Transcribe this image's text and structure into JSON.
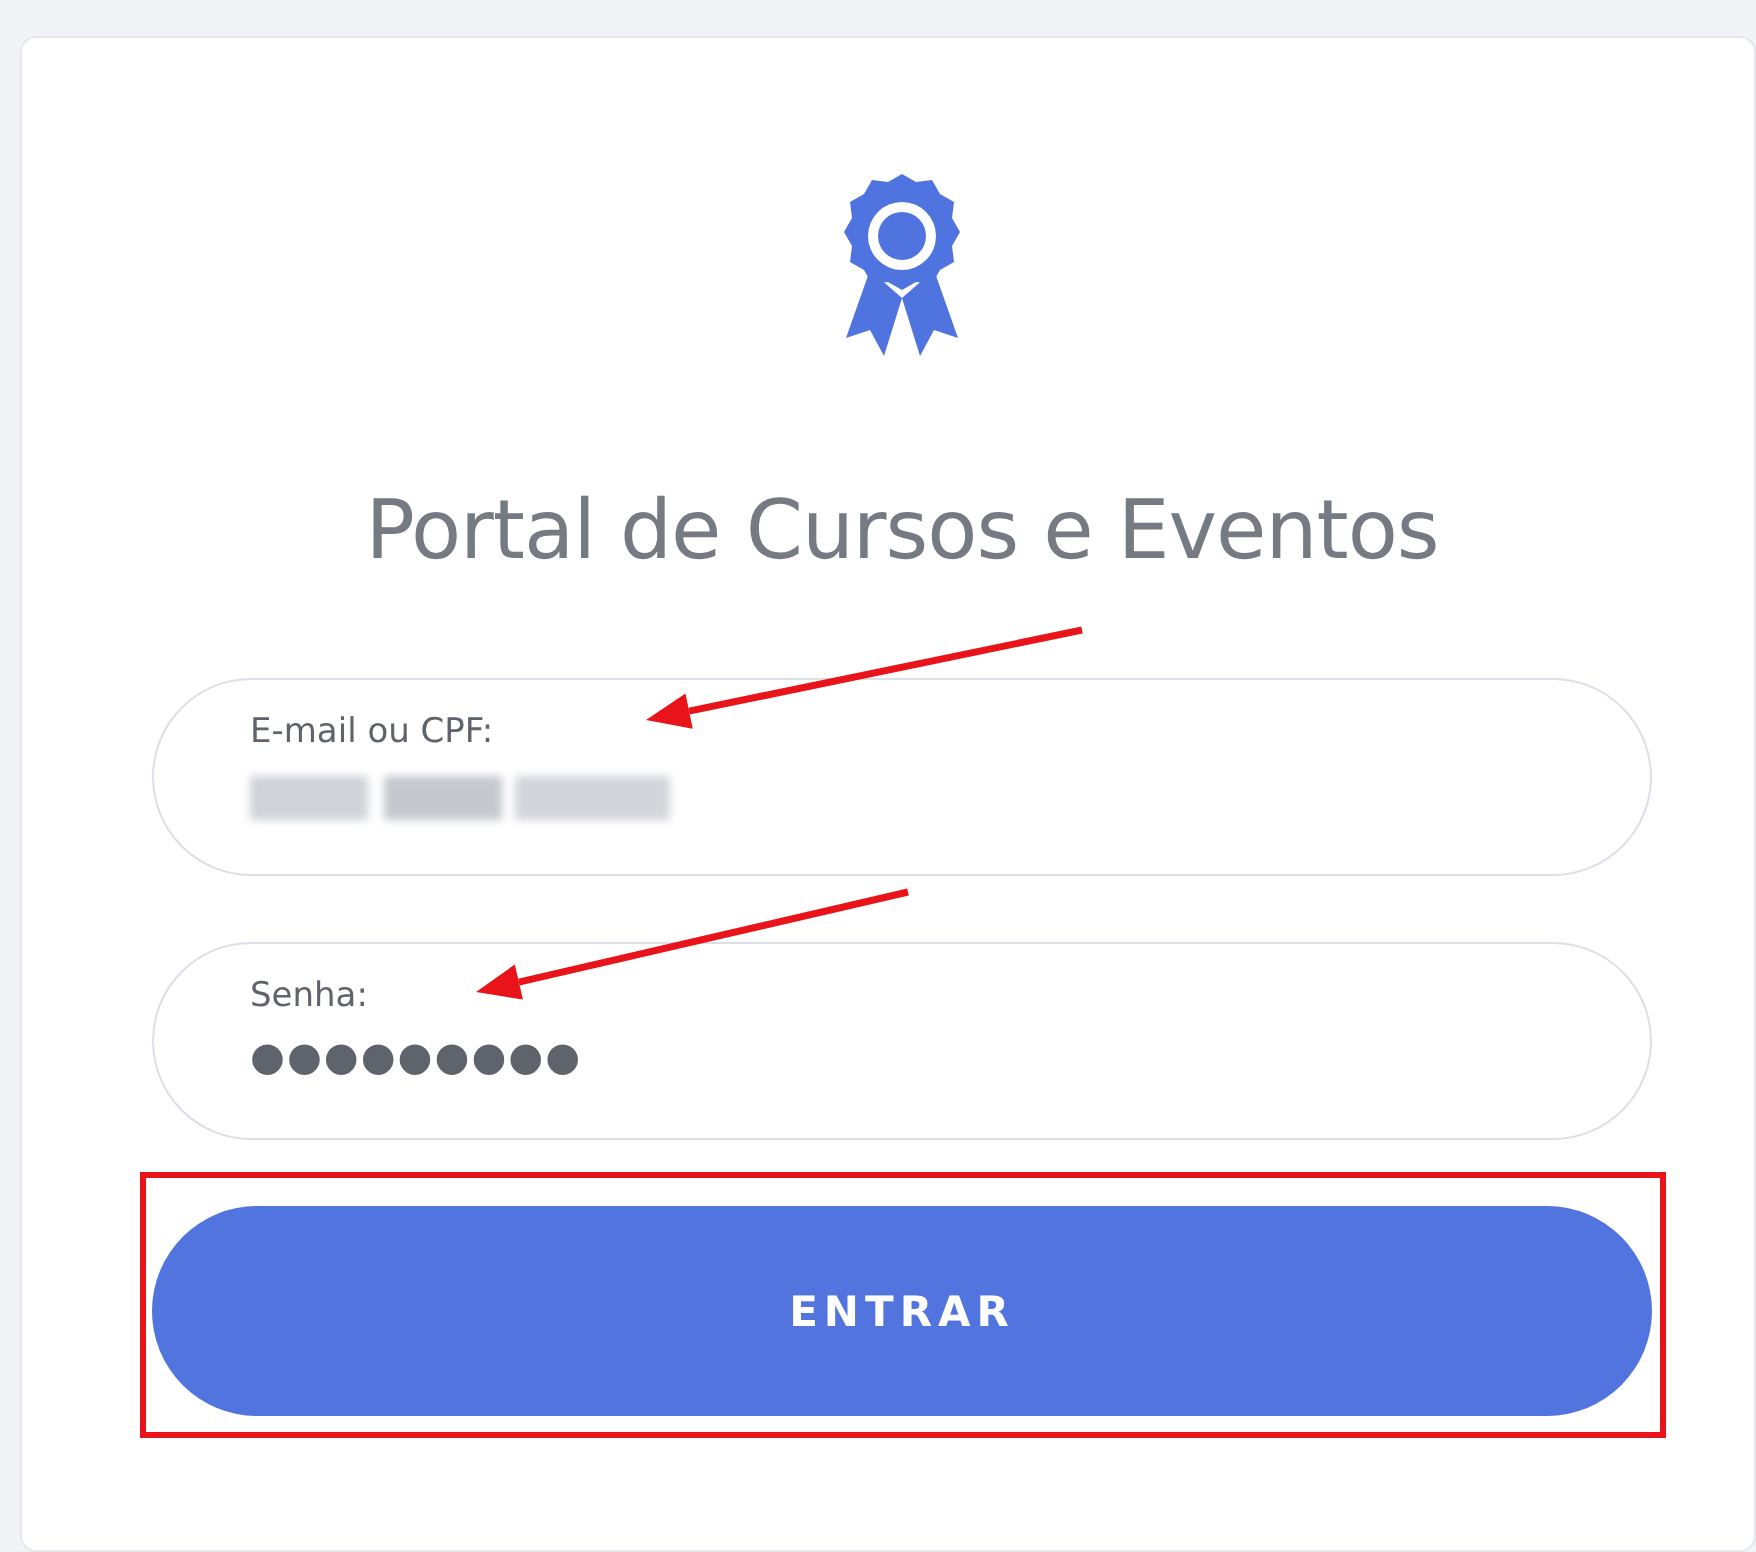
{
  "title": "Portal de Cursos e Eventos",
  "fields": [
    {
      "label": "E-mail ou CPF:",
      "kind": "redacted",
      "arrow_marked": true
    },
    {
      "label": "Senha:",
      "kind": "password",
      "value": "●●●●●●●●●",
      "arrow_marked": true
    }
  ],
  "button": {
    "label": "ENTRAR",
    "boxed": true
  }
}
